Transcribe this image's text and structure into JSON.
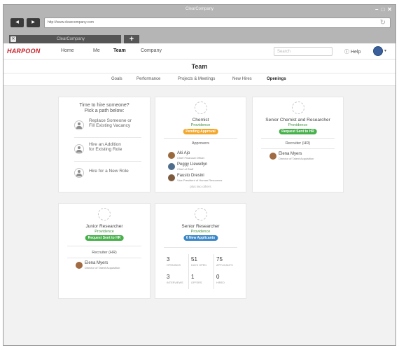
{
  "window": {
    "title": "ClearCompany"
  },
  "browser": {
    "url": "http://www.clearcompany.com",
    "tab_title": "ClearCompany",
    "new_tab_label": "+",
    "back_icon": "left-arrow-icon",
    "forward_icon": "right-arrow-icon"
  },
  "app": {
    "logo": "HARPOON",
    "nav": [
      "Home",
      "Me",
      "Team",
      "Company"
    ],
    "active_nav": "Team",
    "search_placeholder": "Search",
    "help_label": "Help"
  },
  "page": {
    "title": "Team",
    "subnav": [
      "Goals",
      "Performance",
      "Projects & Meetings",
      "New Hires",
      "Openings"
    ],
    "active_subnav": "Openings"
  },
  "hire_card": {
    "heading": [
      "Time to hire someone?",
      "Pick a path below:"
    ],
    "paths": [
      [
        "Replace Someone or",
        "Fill Existing Vacancy"
      ],
      [
        "Hire an Addition",
        "for Existing Role"
      ],
      [
        "Hire for a New Role"
      ]
    ]
  },
  "cards": {
    "chemist": {
      "title": "Chemist",
      "location": "Providence",
      "status": "Pending Approval",
      "section": "Approvers",
      "people": [
        {
          "name": "Aki Ajo",
          "role": "Chief Financial Officer"
        },
        {
          "name": "Peggy Llewellyn",
          "role": "Chief of Staff"
        },
        {
          "name": "Fausto Dresini",
          "role": "Vice President of Human Resources"
        }
      ],
      "more": "plus two others"
    },
    "senior_chemist": {
      "title": "Senior Chemist and Researcher",
      "location": "Providence",
      "status": "Request Sent to HR",
      "section": "Recruiter (HR)",
      "people": [
        {
          "name": "Elena Myers",
          "role": "Director of Talent Acquisition"
        }
      ]
    },
    "junior": {
      "title": "Junior Researcher",
      "location": "Providence",
      "status": "Request Sent to HR",
      "section": "Recruiter (HR)",
      "people": [
        {
          "name": "Elena Myers",
          "role": "Director of Talent Acquisition"
        }
      ]
    },
    "senior_researcher": {
      "title": "Senior Researcher",
      "location": "Providence",
      "status": "6 New Applicants",
      "stats": [
        {
          "value": "3",
          "label": "OPENINGS"
        },
        {
          "value": "51",
          "label": "DAYS OPEN"
        },
        {
          "value": "75",
          "label": "APPLICANTS"
        },
        {
          "value": "3",
          "label": "INTERVIEWS"
        },
        {
          "value": "1",
          "label": "OFFERS"
        },
        {
          "value": "0",
          "label": "HIRED"
        }
      ]
    }
  },
  "colors": {
    "brand": "#c8202a",
    "pending": "#f3a72a",
    "sent": "#46b04a",
    "applicants": "#3a87c8",
    "location": "#3f8f3f"
  }
}
